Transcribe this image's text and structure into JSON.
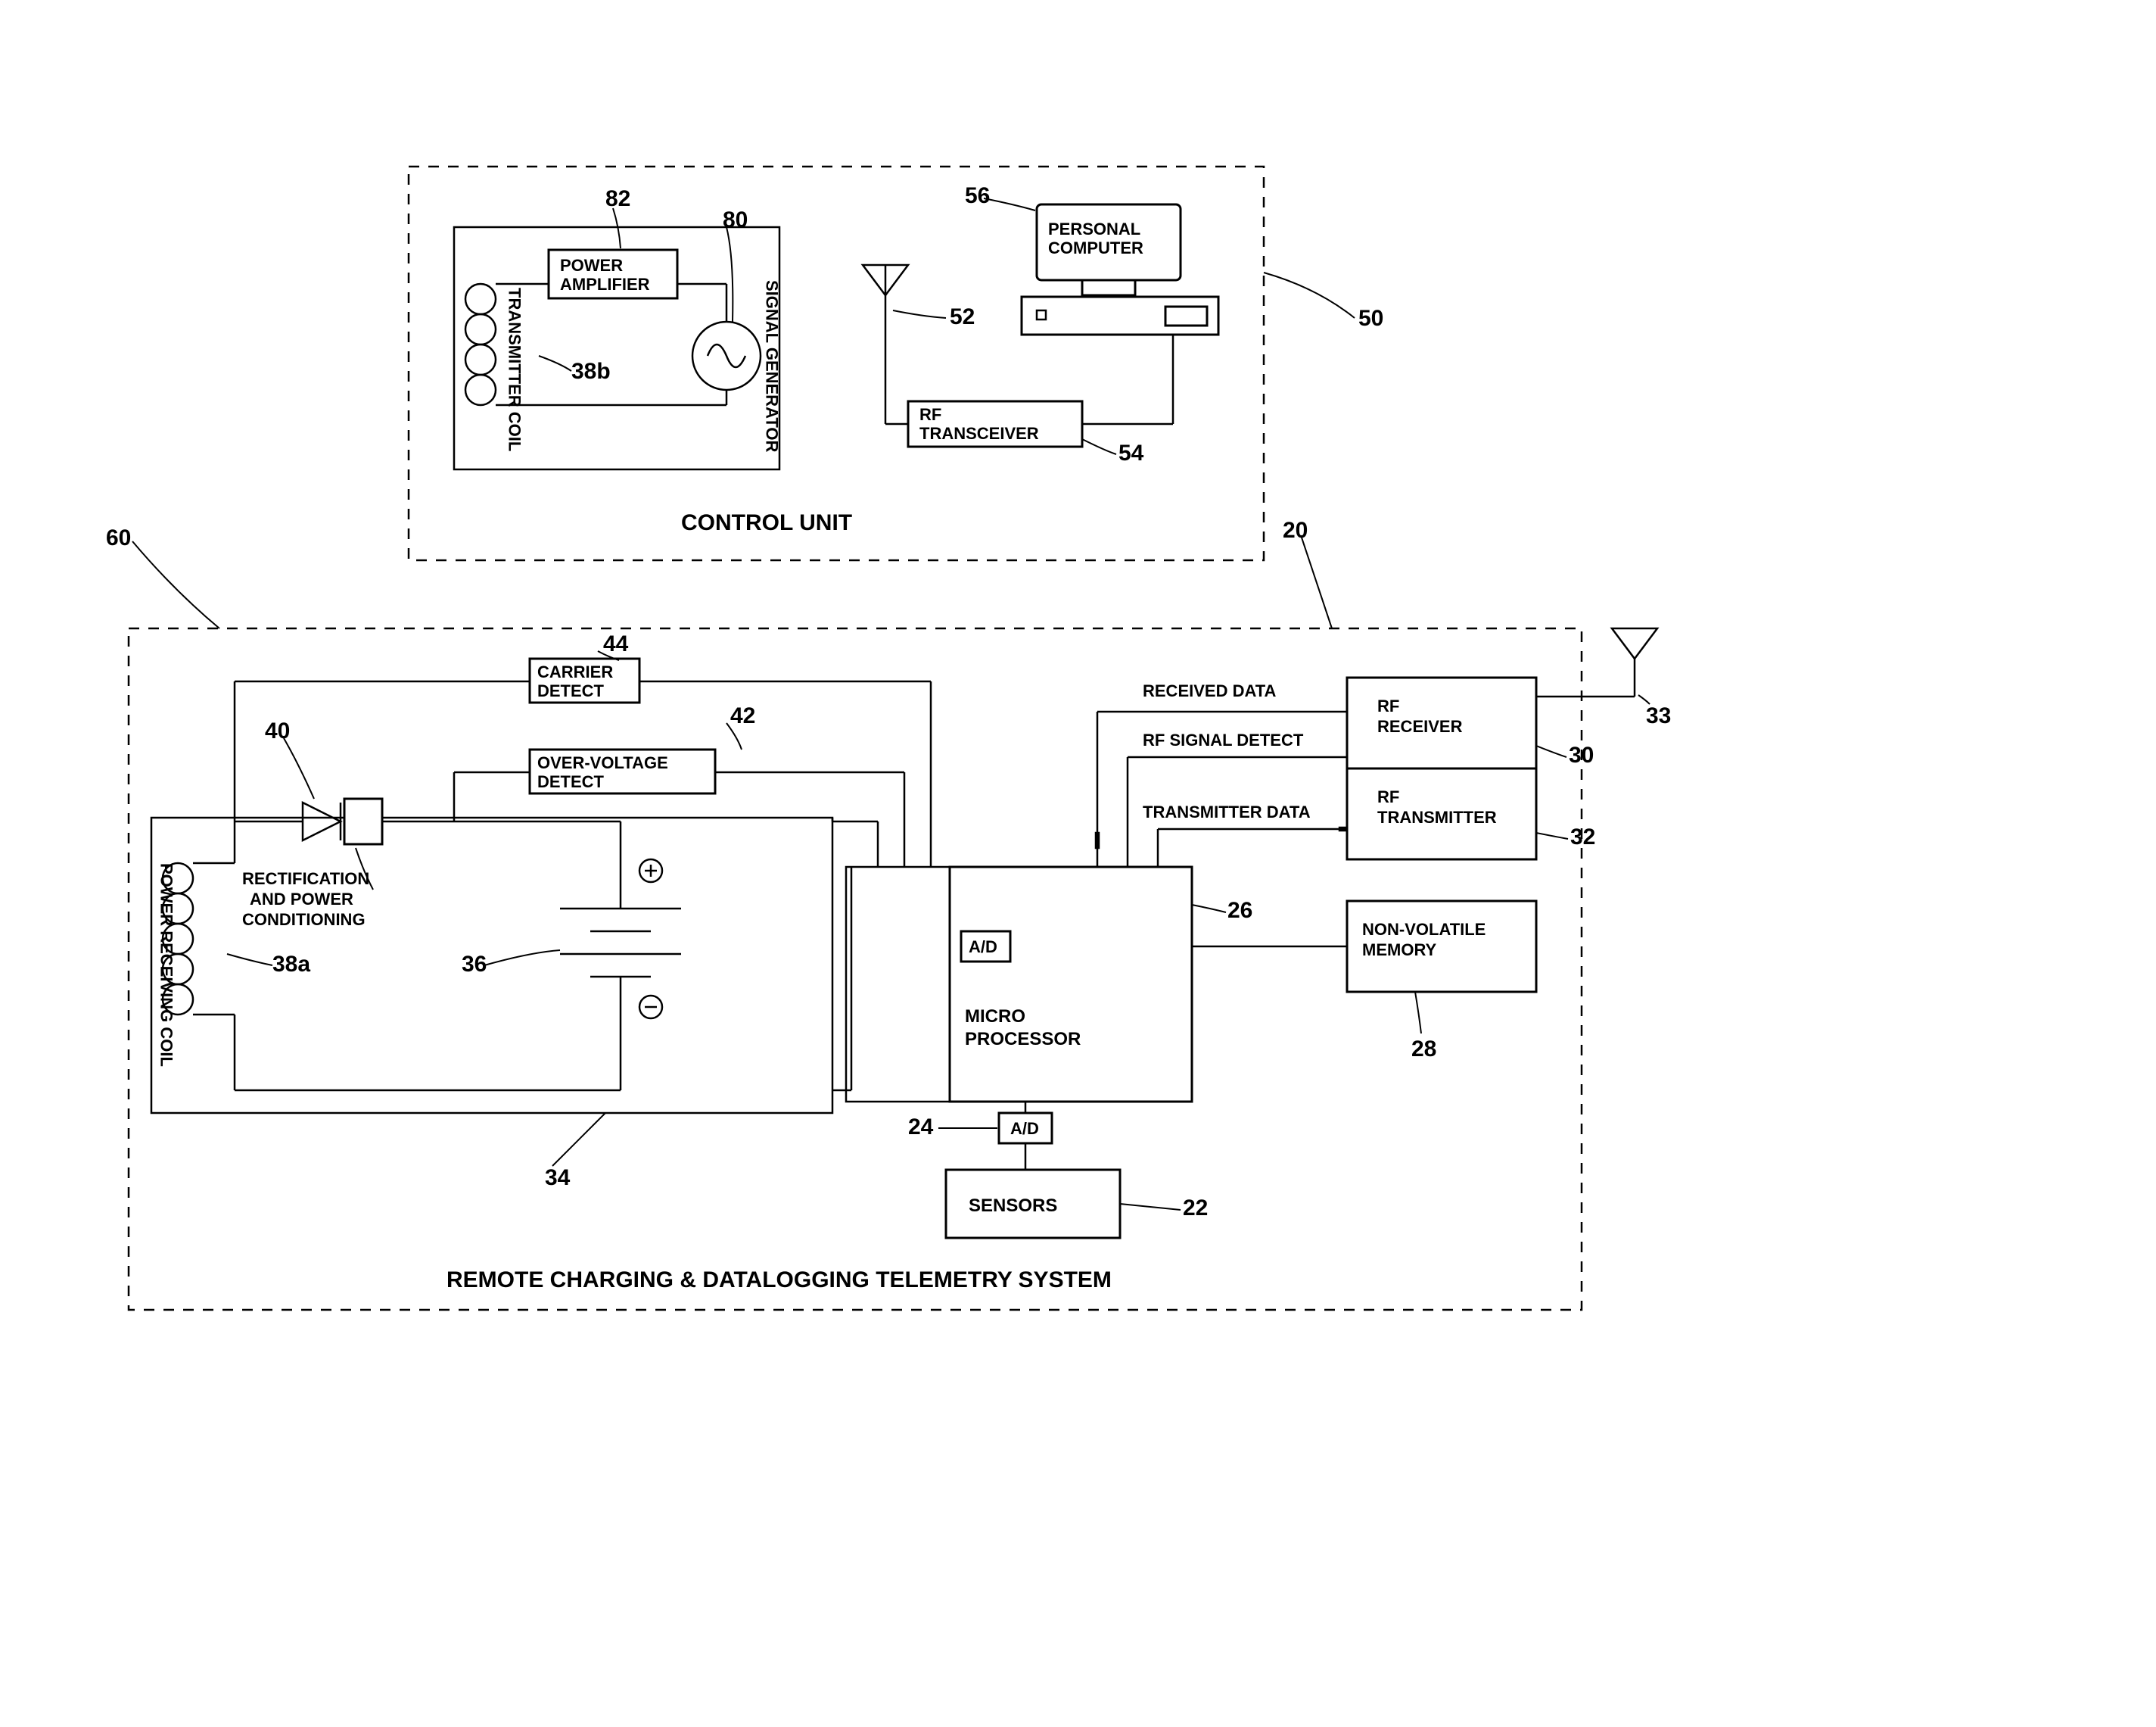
{
  "control_unit": {
    "title": "CONTROL UNIT",
    "ref": "50",
    "antenna_ref": "52",
    "transceiver": {
      "label": "RF TRANSCEIVER",
      "ref": "54"
    },
    "pc": {
      "label": "PERSONAL COMPUTER",
      "ref": "56"
    },
    "amp": {
      "label": "POWER AMPLIFIER",
      "ref": "82"
    },
    "sig_gen": {
      "label": "SIGNAL GENERATOR",
      "ref": "80"
    },
    "tx_coil": {
      "label": "TRANSMITTER COIL",
      "ref": "38b"
    }
  },
  "remote_unit": {
    "title": "REMOTE CHARGING & DATALOGGING TELEMETRY SYSTEM",
    "ref": "20",
    "system_ref": "60",
    "rx_coil": {
      "label": "POWER RECEIVING COIL",
      "ref": "38a"
    },
    "rect": {
      "label1": "RECTIFICATION",
      "label2": "AND POWER",
      "label3": "CONDITIONING",
      "ref": "40"
    },
    "carrier": {
      "label": "CARRIER DETECT",
      "ref": "44"
    },
    "over_v": {
      "label": "OVER-VOLTAGE DETECT",
      "ref": "42"
    },
    "battery": {
      "ref_top": "36",
      "ref_bottom": "34"
    },
    "mpu": {
      "label1": "MICRO",
      "label2": "PROCESSOR",
      "label3": "A/D",
      "ad_ref": "",
      "received_data": "RECEIVED DATA",
      "rf_signal_detect": "RF SIGNAL DETECT",
      "transmitter_data": "TRANSMITTER DATA",
      "ref": "26",
      "ad_block_ref": "24",
      "ad2": "A/D"
    },
    "rf_rx": {
      "label": "RF RECEIVER",
      "ref": "30"
    },
    "rf_tx": {
      "label": "RF TRANSMITTER",
      "ref": "32"
    },
    "nvm": {
      "label": "NON-VOLATILE MEMORY",
      "ref": "28"
    },
    "sensors": {
      "label": "SENSORS",
      "ref": "22"
    },
    "antenna_ref": "33"
  }
}
